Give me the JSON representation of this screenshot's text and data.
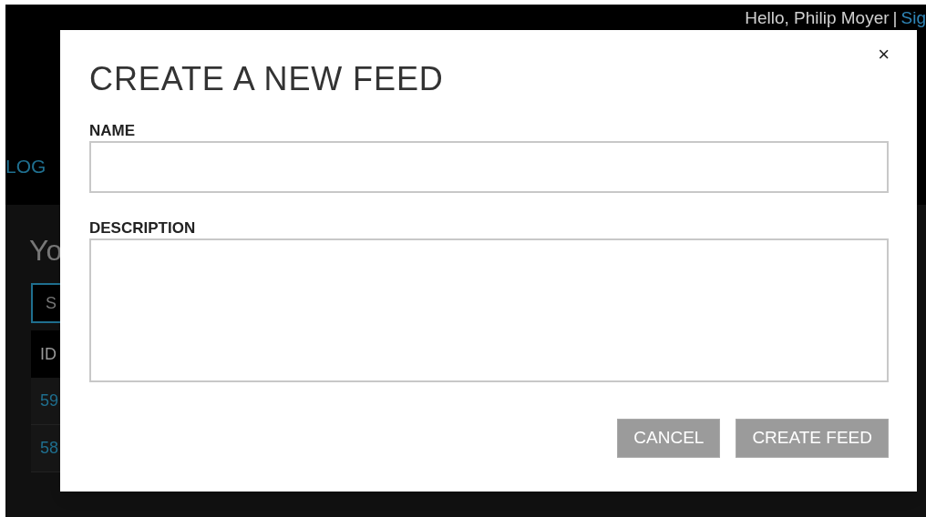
{
  "header": {
    "greeting": "Hello, Philip Moyer",
    "separator": "|",
    "sign_link": "Sig"
  },
  "nav": {
    "link": "LOG"
  },
  "page": {
    "heading": "Yo",
    "search_button": "S",
    "table": {
      "columns": [
        "ID"
      ],
      "rows": [
        [
          "59"
        ],
        [
          "58"
        ]
      ]
    }
  },
  "dialog": {
    "title": "CREATE A NEW FEED",
    "close": "×",
    "fields": [
      {
        "label": "NAME",
        "kind": "input"
      },
      {
        "label": "DESCRIPTION",
        "kind": "textarea"
      }
    ],
    "buttons": [
      "CANCEL",
      "CREATE FEED"
    ]
  }
}
